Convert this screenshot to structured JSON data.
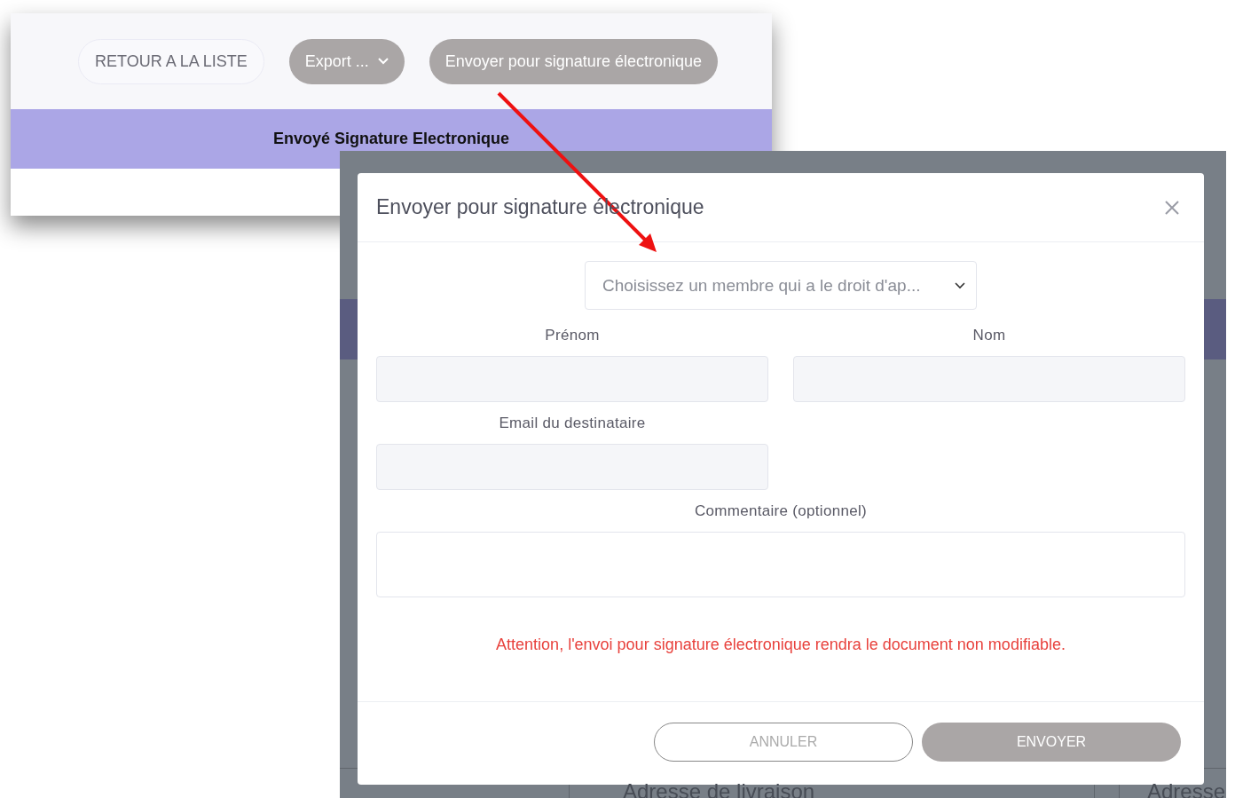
{
  "toolbar": {
    "buttons": [
      {
        "label": "RETOUR A LA LISTE",
        "kind": "outline"
      },
      {
        "label": "Export ...",
        "kind": "dropdown"
      },
      {
        "label": "Envoyer pour signature électronique",
        "kind": "filled"
      }
    ]
  },
  "status_banner": {
    "text": "Envoyé Signature Electronique"
  },
  "dialog": {
    "title": "Envoyer pour signature électronique",
    "member_select": {
      "placeholder": "Choisissez un membre qui a le droit d'ap..."
    },
    "fields": [
      {
        "label": "Prénom",
        "kind": "input"
      },
      {
        "label": "Nom",
        "kind": "input"
      },
      {
        "label": "Email du destinataire",
        "kind": "input"
      },
      {
        "label": "Commentaire (optionnel)",
        "kind": "textarea"
      }
    ],
    "warning": "Attention, l'envoi pour signature électronique rendra le document non modifiable.",
    "buttons": [
      {
        "label": "ANNULER",
        "kind": "secondary"
      },
      {
        "label": "ENVOYER",
        "kind": "primary"
      }
    ]
  },
  "background_page": {
    "column_headers": [
      "Adresse de livraison",
      "Adresse"
    ]
  }
}
